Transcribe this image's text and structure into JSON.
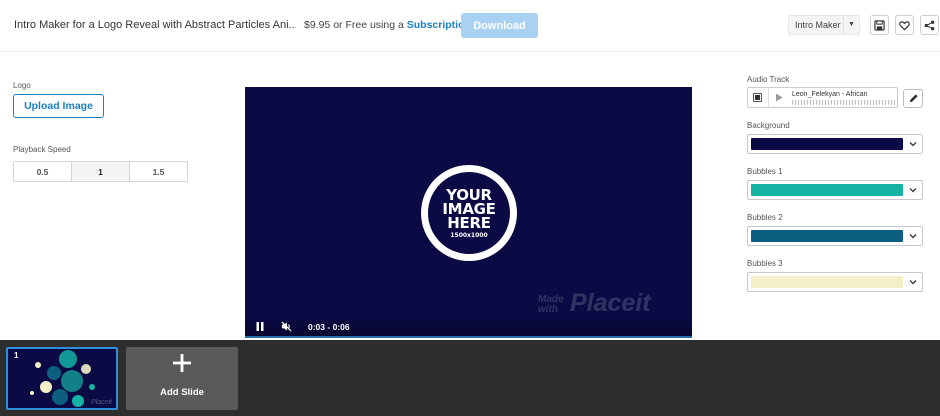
{
  "header": {
    "title": "Intro Maker for a Logo Reveal with Abstract Particles Ani...",
    "price": "$9.95",
    "price_suffix": " or Free using a ",
    "subscription_link": "Subscription",
    "download_label": "Download",
    "maker_select": "Intro Maker"
  },
  "left_panel": {
    "logo_label": "Logo",
    "upload_label": "Upload Image",
    "speed_label": "Playback Speed",
    "speeds": [
      "0.5",
      "1",
      "1.5"
    ],
    "selected_speed": "1"
  },
  "video": {
    "placeholder_line1": "YOUR",
    "placeholder_line2": "IMAGE",
    "placeholder_line3": "HERE",
    "placeholder_size": "1500x1000",
    "watermark_made": "Made",
    "watermark_with": "with",
    "watermark_brand": "Placeit",
    "time_range": "0:03 - 0:06"
  },
  "right_panel": {
    "audio_label": "Audio Track",
    "audio_name": "Leon_Felekyan - African",
    "background_label": "Background",
    "background_color": "#0b0a44",
    "bubbles1_label": "Bubbles 1",
    "bubbles1_color": "#14b3a4",
    "bubbles2_label": "Bubbles 2",
    "bubbles2_color": "#0c5f7e",
    "bubbles3_label": "Bubbles 3",
    "bubbles3_color": "#f3efc6"
  },
  "slides": {
    "items": [
      {
        "number": "1",
        "mark": "Placeit"
      }
    ],
    "add_label": "Add Slide"
  },
  "colors": {
    "accent": "#1a7fc1",
    "download_disabled": "#a9d1f2",
    "video_bg": "#0b0a44",
    "strip_bg": "#2d2d2d"
  }
}
